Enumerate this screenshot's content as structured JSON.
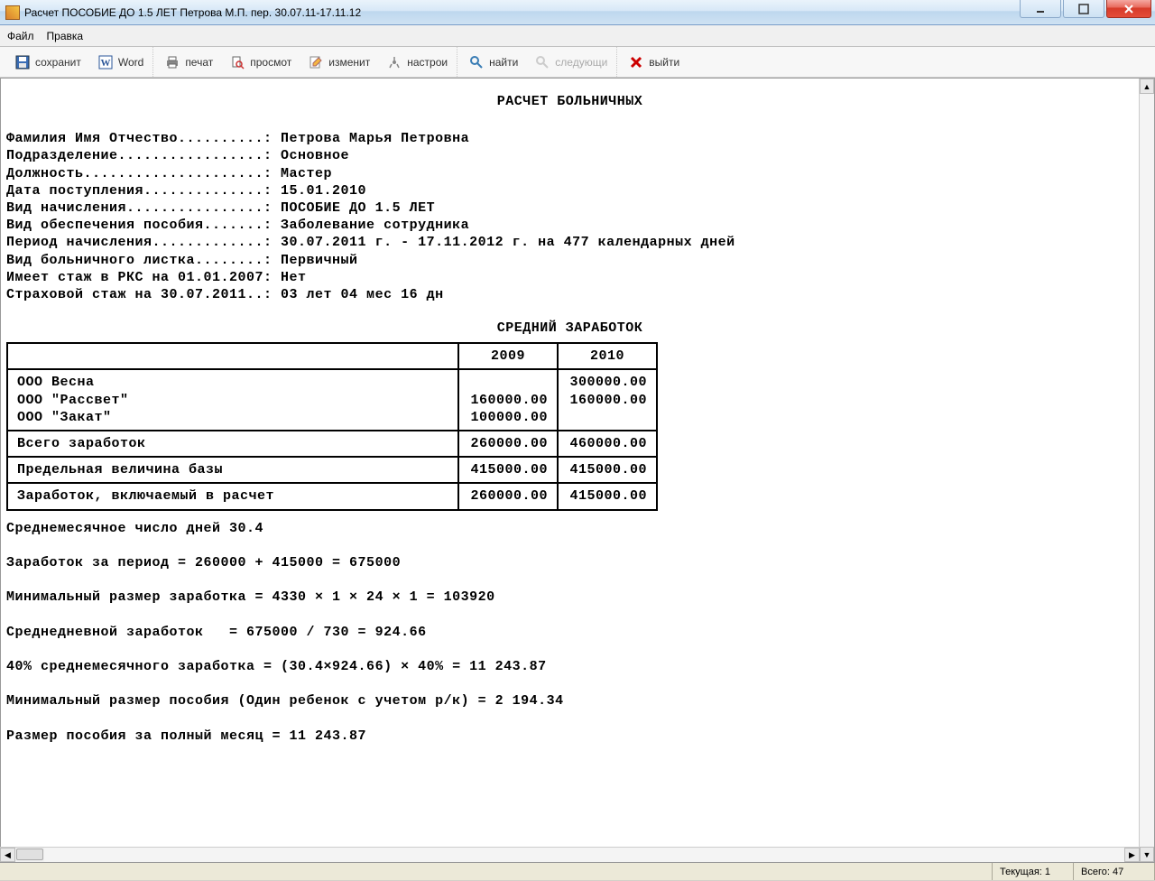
{
  "window": {
    "title": "Расчет ПОСОБИЕ ДО 1.5 ЛЕТ Петрова М.П. пер. 30.07.11-17.11.12"
  },
  "menu": {
    "file": "Файл",
    "edit": "Правка"
  },
  "toolbar": {
    "save": "сохранит",
    "word": "Word",
    "print": "печат",
    "preview": "просмот",
    "change": "изменит",
    "settings": "настрои",
    "find": "найти",
    "next": "следующи",
    "exit": "выйти"
  },
  "doc": {
    "title": "РАСЧЕТ БОЛЬНИЧНЫХ",
    "lines": {
      "fio": "Фамилия Имя Отчество..........: Петрова Марья Петровна",
      "dept": "Подразделение.................: Основное",
      "position": "Должность.....................: Мастер",
      "hire": "Дата поступления..............: 15.01.2010",
      "accrual": "Вид начисления................: ПОСОБИЕ ДО 1.5 ЛЕТ",
      "provision": "Вид обеспечения пособия.......: Заболевание сотрудника",
      "period": "Период начисления.............: 30.07.2011 г. - 17.11.2012 г. на 477 календарных дней",
      "leaftype": "Вид больничного листка........: Первичный",
      "rks": "Имеет стаж в РКС на 01.01.2007: Нет",
      "insurance": "Страховой стаж на 30.07.2011..: 03 лет 04 мес 16 дн"
    },
    "avg_title": "СРЕДНИЙ  ЗАРАБОТОК",
    "table": {
      "year1": "2009",
      "year2": "2010",
      "companies_block": "ООО Весна\nООО \"Рассвет\"\nООО \"Закат\"",
      "companies_y1": "\n160000.00\n100000.00",
      "companies_y2": "300000.00\n160000.00\n",
      "total_label": "Всего заработок",
      "total_y1": "260000.00",
      "total_y2": "460000.00",
      "base_label": "Предельная величина базы",
      "base_y1": "415000.00",
      "base_y2": "415000.00",
      "incl_label": "Заработок, включаемый в расчет",
      "incl_y1": "260000.00",
      "incl_y2": "415000.00"
    },
    "calc": {
      "avg_days": "Среднемесячное число дней 30.4",
      "earn_sum": "Заработок за период = 260000 + 415000 = 675000",
      "min_earn": "Минимальный размер заработка = 4330 × 1 × 24 × 1 = 103920",
      "daily": "Среднедневной заработок   = 675000 / 730 = 924.66",
      "pct40": "40% среднемесячного заработка = (30.4×924.66) × 40% = 11 243.87",
      "min_benefit": "Минимальный размер пособия (Один ребенок с учетом р/к) = 2 194.34",
      "full_month": "Размер пособия за полный месяц = 11 243.87"
    }
  },
  "status": {
    "current_label": "Текущая:",
    "current_value": "1",
    "total_label": "Всего:",
    "total_value": "47"
  }
}
